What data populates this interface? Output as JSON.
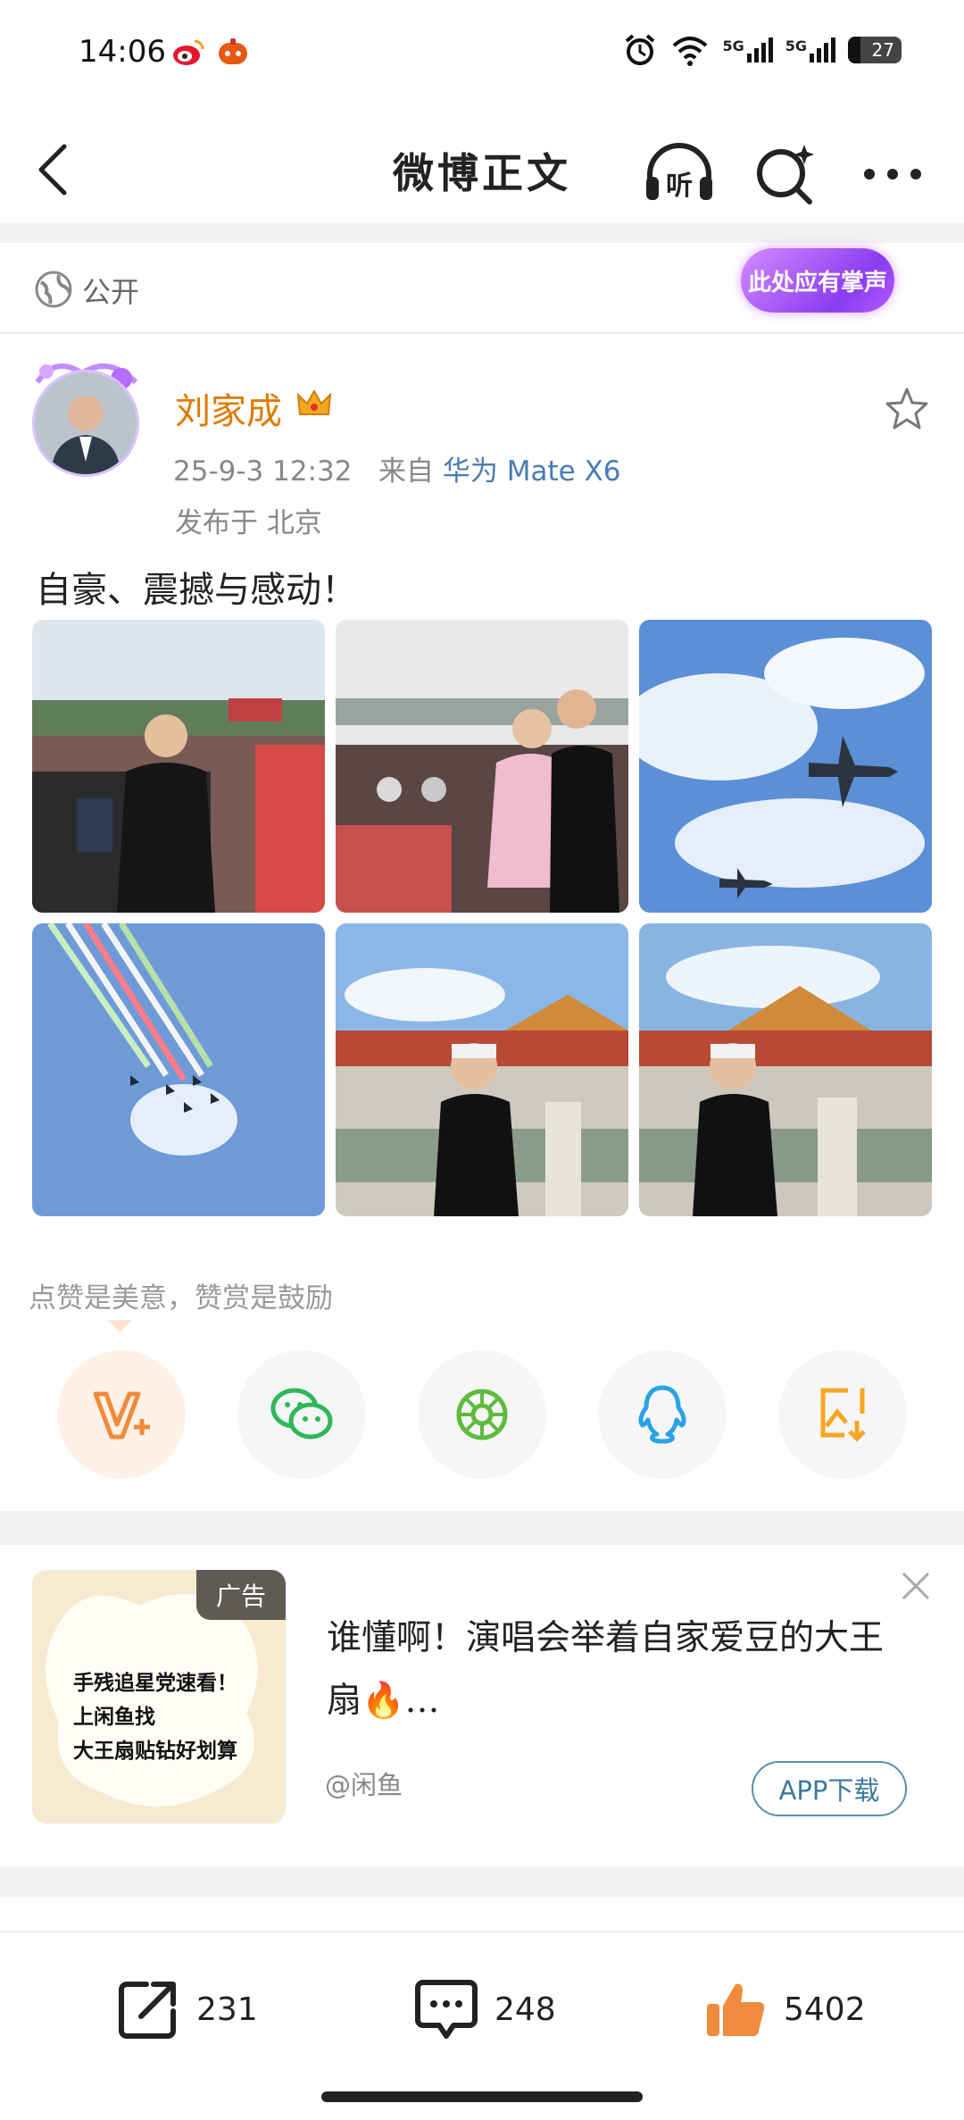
{
  "status_bar": {
    "time": "14:06",
    "signal_1": "5G",
    "signal_2": "5G",
    "battery": "27"
  },
  "nav": {
    "title": "微博正文",
    "listen_label": "听"
  },
  "visibility": {
    "label": "公开",
    "sticker": "此处应有掌声"
  },
  "post": {
    "author": "刘家成",
    "timestamp": "25-9-3 12:32",
    "source_prefix": "来自",
    "device": "华为 Mate X6",
    "location": "发布于 北京",
    "text": "自豪、震撼与感动！"
  },
  "reward_hint": "点赞是美意，赞赏是鼓励",
  "share_icons": [
    "v-plus-icon",
    "wechat-icon",
    "moments-icon",
    "qq-icon",
    "save-image-icon"
  ],
  "ad": {
    "tag": "广告",
    "image_lines": [
      "手残追星党速看！",
      "上闲鱼找",
      "大王扇贴钻好划算"
    ],
    "title": "谁懂啊！演唱会举着自家爱豆的大王扇🔥…",
    "source": "@闲鱼",
    "download_label": "APP下载"
  },
  "actions": {
    "reposts": "231",
    "comments": "248",
    "likes": "5402"
  },
  "colors": {
    "author": "#e07a00",
    "device_link": "#4a7bb5",
    "like": "#f08a3c"
  }
}
